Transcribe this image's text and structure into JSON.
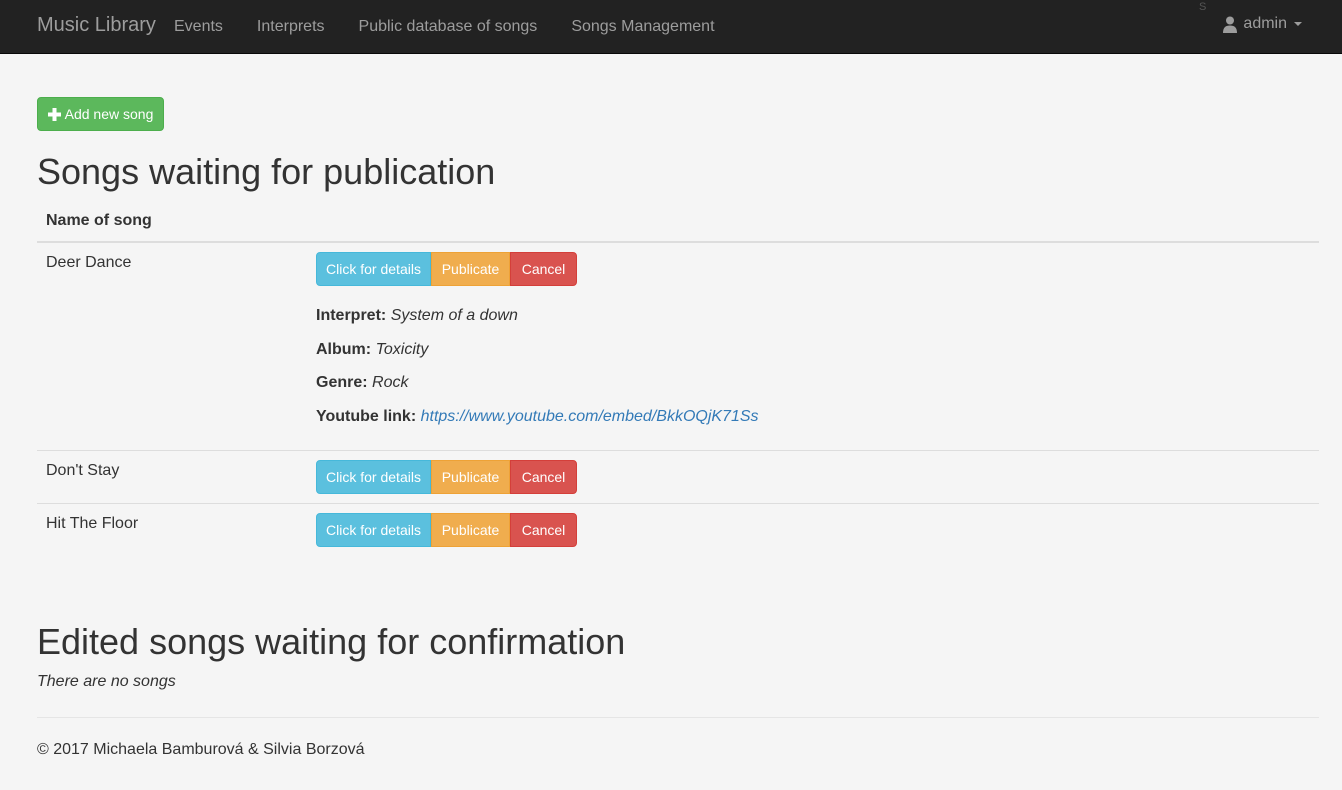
{
  "navbar": {
    "brand": "Music Library",
    "links": [
      "Events",
      "Interprets",
      "Public database of songs",
      "Songs Management"
    ],
    "stray_char": "S",
    "user": "admin"
  },
  "actions": {
    "add_song": "Add new song"
  },
  "pending": {
    "title": "Songs waiting for publication",
    "column_header": "Name of song",
    "button_labels": {
      "details": "Click for details",
      "publicate": "Publicate",
      "cancel": "Cancel"
    },
    "rows": [
      {
        "name": "Deer Dance",
        "expanded": true
      },
      {
        "name": "Don't Stay",
        "expanded": false
      },
      {
        "name": "Hit The Floor",
        "expanded": false
      }
    ],
    "details": {
      "interpret_label": "Interpret:",
      "interpret": "System of a down",
      "album_label": "Album:",
      "album": "Toxicity",
      "genre_label": "Genre:",
      "genre": "Rock",
      "youtube_label": "Youtube link:",
      "youtube": "https://www.youtube.com/embed/BkkOQjK71Ss"
    }
  },
  "edited": {
    "title": "Edited songs waiting for confirmation",
    "empty_text": "There are no songs"
  },
  "footer": {
    "copyright": "© 2017 Michaela Bamburová & Silvia Borzová"
  },
  "colors": {
    "navbar_bg": "#222222",
    "success": "#5cb85c",
    "info": "#5bc0de",
    "warning": "#f0ad4e",
    "danger": "#d9534f",
    "link": "#337ab7"
  }
}
